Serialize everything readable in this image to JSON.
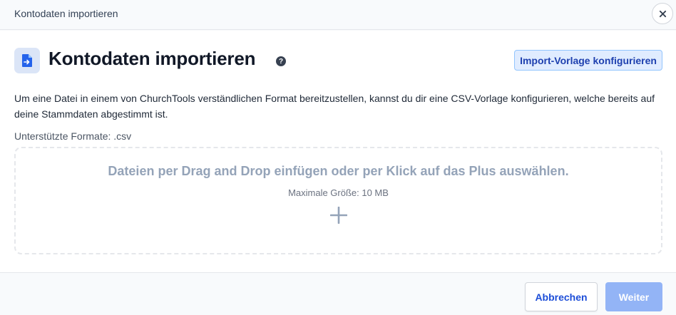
{
  "dialog": {
    "title": "Kontodaten importieren",
    "close_icon": "close-icon"
  },
  "header": {
    "icon": "file-import-icon",
    "title": "Kontodaten importieren",
    "help_icon": "help-icon",
    "help_glyph": "?",
    "template_button_label": "Import-Vorlage konfigurieren"
  },
  "body": {
    "description": "Um eine Datei in einem von ChurchTools verständlichen Format bereitzustellen, kannst du dir eine CSV-Vorlage konfigurieren, welche bereits auf deine Stammdaten abgestimmt ist.",
    "supported_formats": "Unterstützte Formate: .csv"
  },
  "dropzone": {
    "main_text": "Dateien per Drag and Drop einfügen oder per Klick auf das Plus auswählen.",
    "max_size_text": "Maximale Größe: 10 MB",
    "add_icon": "plus-icon"
  },
  "footer": {
    "cancel_label": "Abbrechen",
    "next_label": "Weiter"
  },
  "colors": {
    "accent": "#1d4ed8",
    "button_secondary_bg": "#e0ecff",
    "primary_disabled": "#93b4f6",
    "dropzone_text": "#94a3b8"
  }
}
